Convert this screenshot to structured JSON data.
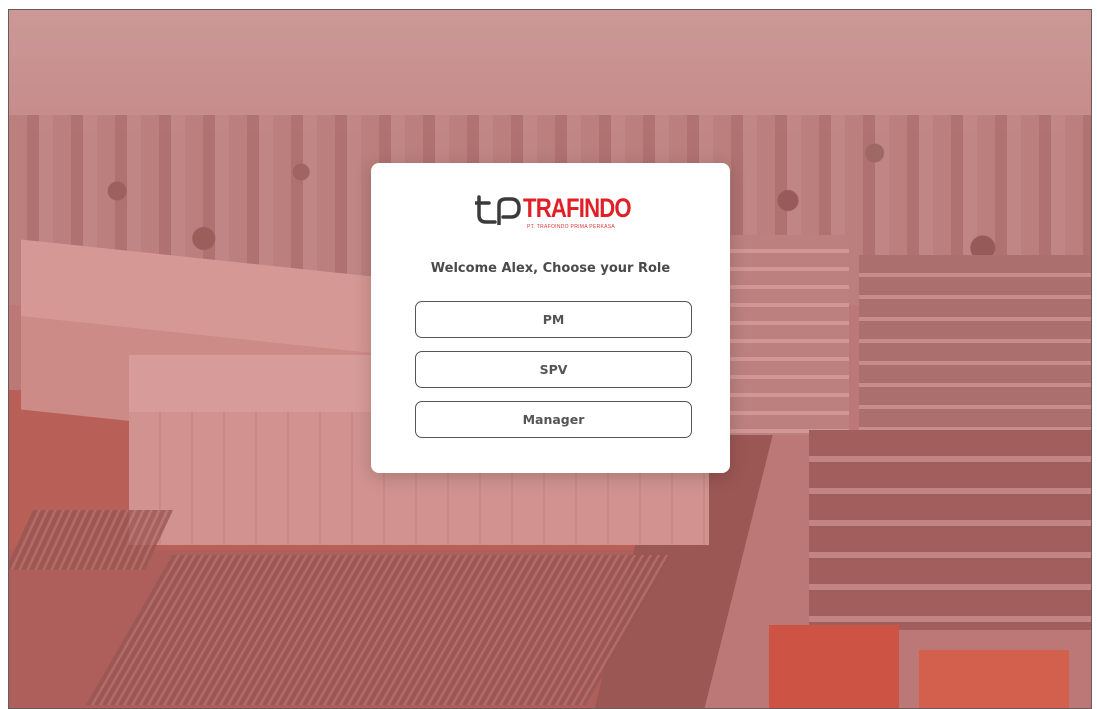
{
  "brand": {
    "name": "TRAFINDO",
    "subtitle": "PT. TRAFOINDO PRIMA PERKASA",
    "accent_color": "#e01f26",
    "mark_icon": "tp-logo-mark"
  },
  "dialog": {
    "heading": "Welcome Alex, Choose your Role",
    "roles": [
      {
        "label": "PM"
      },
      {
        "label": "SPV"
      },
      {
        "label": "Manager"
      }
    ]
  }
}
